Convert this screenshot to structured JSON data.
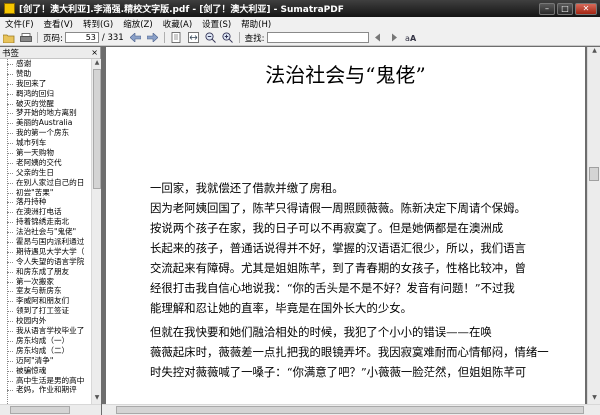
{
  "window": {
    "title": "[剑了！澳大利亚].李涌强.精校文字版.pdf - [剑了！澳大利亚] - SumatraPDF",
    "minimize": "–",
    "maximize": "□",
    "close": "✕"
  },
  "menu": [
    "文件(F)",
    "查看(V)",
    "转到(G)",
    "缩放(Z)",
    "收藏(A)",
    "设置(S)",
    "帮助(H)"
  ],
  "toolbar": {
    "page_label": "页码:",
    "page_value": "53",
    "page_total": "/ 331",
    "find_label": "查找:",
    "find_value": ""
  },
  "sidebar": {
    "header": "书签",
    "close": "×",
    "items": [
      "感谢",
      "赞助",
      "我回来了",
      "羁鸿的回归",
      "破灭的觉醒",
      "梦开始的地方离别",
      "美丽的Australia",
      "我的第一个房东",
      "城市列车",
      "第一天购物",
      "老阿姨的交代",
      "父亲的生日",
      "在别人家过自己的日",
      "初尝\"苦果\"",
      "落丹持种",
      "在澳洲打电话",
      "持着锦绣走南北",
      "法治社会与\"鬼佬\"",
      "霍昂与国内派利通过",
      "期待遇见大学大学（",
      "令人失望的语言学院",
      "和房东成了朋友",
      "第一次搬家",
      "室友与新房东",
      "李威阿和朋友们",
      "领到了打工签证",
      "校园内外",
      "我从语言学校毕业了",
      "房东均成（一）",
      "房东均成（二）",
      "迈阿\"清争\"",
      "被骗惊魂",
      "高中生活是男的高中",
      "老妈，作业和期评"
    ]
  },
  "document": {
    "title": "法治社会与“鬼佬”",
    "lines": [
      "一回家，我就偿还了借款并缴了房租。",
      "因为老阿姨回国了，陈芊只得请假一周照顾薇薇。陈新决定下周请个保姆。",
      "按说两个孩子在家，我的日子可以不再寂寞了。但是她俩都是在澳洲成",
      "长起来的孩子，普通话说得并不好，掌握的汉语语汇很少，所以，我们语言",
      "交流起来有障碍。尤其是姐姐陈芊，到了青春期的女孩子，性格比较冲，曾",
      "经很打击我自信心地说我：“你的舌头是不是不好？发音有问题！”不过我",
      "能理解和忍让她的直率，毕竟是在国外长大的少女。",
      "但就在我快要和她们融洽相处的时候，我犯了个小小的错误——在唤",
      "薇薇起床时，薇薇差一点扎把我的眼镜弄坏。我因寂寞难耐而心情郁闷，情绪一",
      "时失控对薇薇喊了一嗓子：“你满意了吧？”小薇薇一脸茫然，但姐姐陈芊可"
    ]
  }
}
